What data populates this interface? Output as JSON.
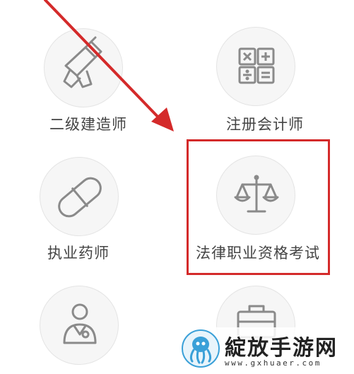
{
  "grid": {
    "items": [
      {
        "label": "二级建造师",
        "icon": "drill-icon"
      },
      {
        "label": "注册会计师",
        "icon": "calculator-icon"
      },
      {
        "label": "执业药师",
        "icon": "capsule-icon"
      },
      {
        "label": "法律职业资格考试",
        "icon": "scales-icon"
      },
      {
        "label": "",
        "icon": "doctor-icon"
      },
      {
        "label": "",
        "icon": "briefcase-icon"
      }
    ]
  },
  "annotation": {
    "highlight_color": "#d42a2a",
    "highlighted_item": "法律职业资格考试"
  },
  "watermark": {
    "title": "綻放手游网",
    "url": "www.gxhuaer.com"
  }
}
